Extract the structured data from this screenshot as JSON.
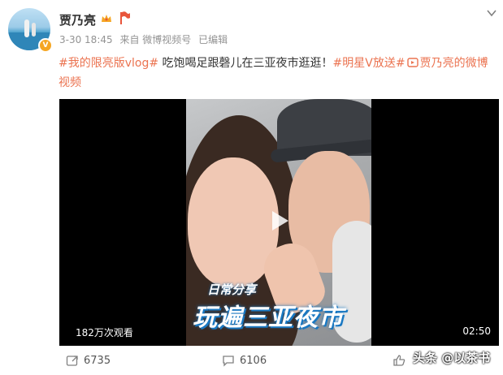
{
  "header": {
    "username": "贾乃亮",
    "time": "3-30 18:45",
    "source": "来自 微博视频号",
    "edited": "已编辑",
    "crown_icon": "crown-icon",
    "flag_icon": "flag-icon",
    "menu_icon": "chevron-down-icon"
  },
  "post": {
    "tag1": "#我的限亮版vlog#",
    "text": " 吃饱喝足跟磬儿在三亚夜市逛逛！",
    "tag2": "#明星V放送#",
    "link_icon": "video-link-icon",
    "link_text": "贾乃亮的微博视频"
  },
  "video": {
    "subtitle_small": "日常分享",
    "subtitle_big": "玩遍三亚夜市",
    "views": "182万次观看",
    "duration": "02:50",
    "play_icon": "play-icon"
  },
  "actions": {
    "share_count": "6735",
    "comment_count": "6106",
    "like_label": "",
    "watermark": "头条 @以茶书"
  },
  "colors": {
    "accent": "#eb7350",
    "badge": "#f5a623",
    "video_bg": "#000000"
  }
}
